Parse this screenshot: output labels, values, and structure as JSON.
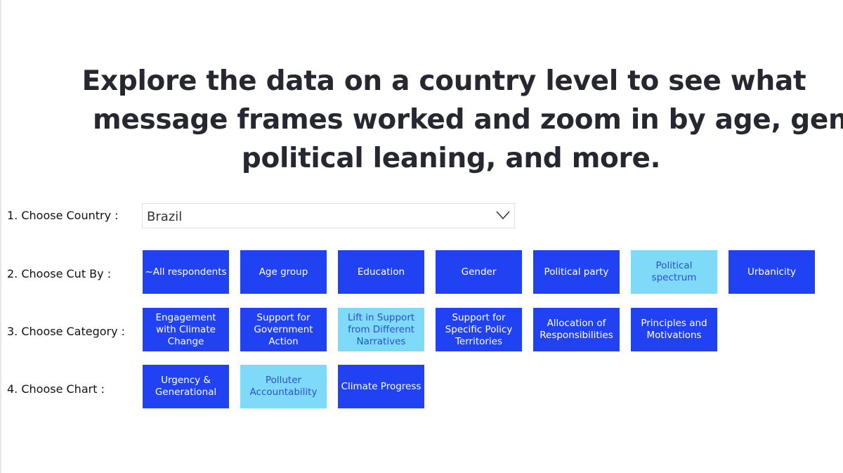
{
  "header": {
    "title_line1": "Explore the data on a country level to see what",
    "title_line2": "message frames worked and zoom in by age, gender,",
    "title_line3": "political leaning, and more."
  },
  "labels": {
    "country": "1. Choose Country :",
    "cut_by": "2. Choose Cut By :",
    "category": "3. Choose Category :",
    "chart": "4. Choose Chart :"
  },
  "country_select": {
    "value": "Brazil",
    "icon": "chevron-down-icon"
  },
  "cut_by": [
    {
      "label": "~All respondents",
      "selected": false
    },
    {
      "label": "Age group",
      "selected": false
    },
    {
      "label": "Education",
      "selected": false
    },
    {
      "label": "Gender",
      "selected": false
    },
    {
      "label": "Political party",
      "selected": false
    },
    {
      "label": "Political spectrum",
      "selected": true
    },
    {
      "label": "Urbanicity",
      "selected": false
    }
  ],
  "category": [
    {
      "label": "Engagement with Climate Change",
      "selected": false
    },
    {
      "label": "Support for Government Action",
      "selected": false
    },
    {
      "label": "Lift in Support from Different Narratives",
      "selected": true
    },
    {
      "label": "Support for Specific Policy Territories",
      "selected": false
    },
    {
      "label": "Allocation of Responsibilities",
      "selected": false
    },
    {
      "label": "Principles and Motivations",
      "selected": false
    }
  ],
  "chart": [
    {
      "label": "Urgency & Generational",
      "selected": false
    },
    {
      "label": "Polluter Accountability",
      "selected": true
    },
    {
      "label": "Climate Progress",
      "selected": false
    }
  ],
  "colors": {
    "button": "#2142f2",
    "button_selected": "#7fdaf9",
    "selected_text": "#2a4fd6"
  }
}
